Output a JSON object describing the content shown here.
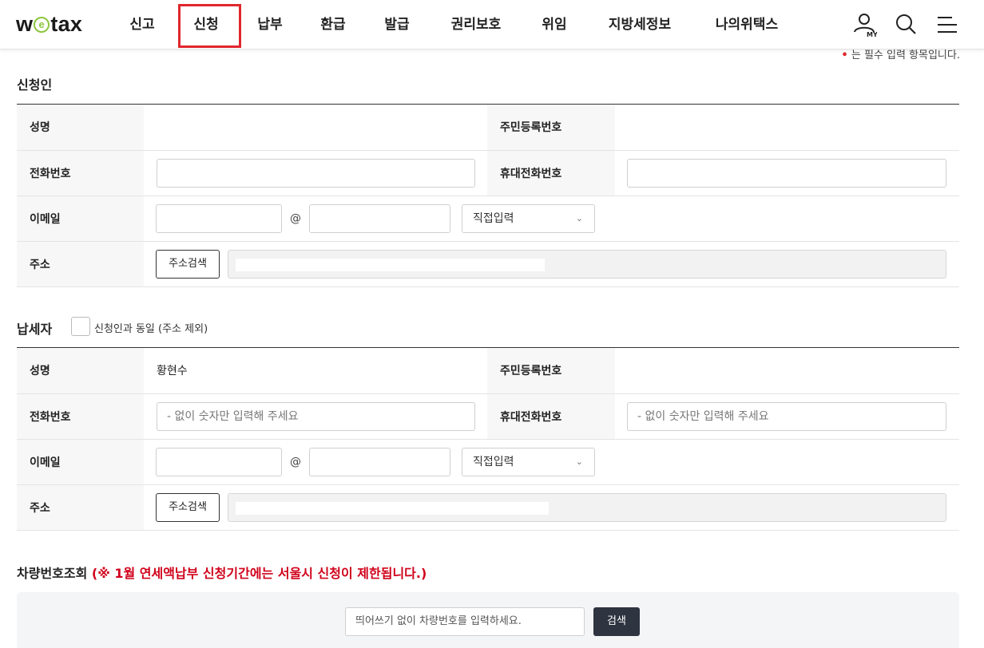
{
  "header": {
    "logo": "wetax",
    "nav": [
      "신고",
      "신청",
      "납부",
      "환급",
      "발급",
      "권리보호",
      "위임",
      "지방세정보",
      "나의위택스"
    ],
    "active_nav": "신청",
    "my_label": "MY",
    "icons": [
      "user-my-icon",
      "search-icon",
      "menu-icon"
    ]
  },
  "required_note": "는 필수 입력 항목입니다.",
  "applicant": {
    "title": "신청인",
    "name_label": "성명",
    "name_value": "",
    "rrn_label": "주민등록번호",
    "rrn_value": "",
    "phone_label": "전화번호",
    "phone_value": "",
    "mobile_label": "휴대전화번호",
    "mobile_value": "",
    "email_label": "이메일",
    "email_id": "",
    "email_domain": "",
    "at": "@",
    "domain_select": "직접입력",
    "address_label": "주소",
    "address_button": "주소검색"
  },
  "taxpayer": {
    "title": "납세자",
    "same_checkbox_label": "신청인과 동일 (주소 제외)",
    "name_label": "성명",
    "name_value": "황현수",
    "rrn_label": "주민등록번호",
    "rrn_value": "",
    "phone_label": "전화번호",
    "phone_placeholder": "- 없이 숫자만 입력해 주세요",
    "mobile_label": "휴대전화번호",
    "mobile_placeholder": "- 없이 숫자만 입력해 주세요",
    "email_label": "이메일",
    "at": "@",
    "domain_select": "직접입력",
    "address_label": "주소",
    "address_button": "주소검색"
  },
  "vehicle": {
    "title": "차량번호조회",
    "warning": "(※ 1월 연세액납부 신청기간에는 서울시 신청이 제한됩니다.)",
    "placeholder": "띄어쓰기 없이 차량번호를 입력하세요.",
    "search_button": "검색"
  },
  "colors": {
    "accent_red": "#e0262c",
    "warning_red": "#d0021b",
    "logo_green": "#8cc63f",
    "search_button_bg": "#2e3440"
  }
}
